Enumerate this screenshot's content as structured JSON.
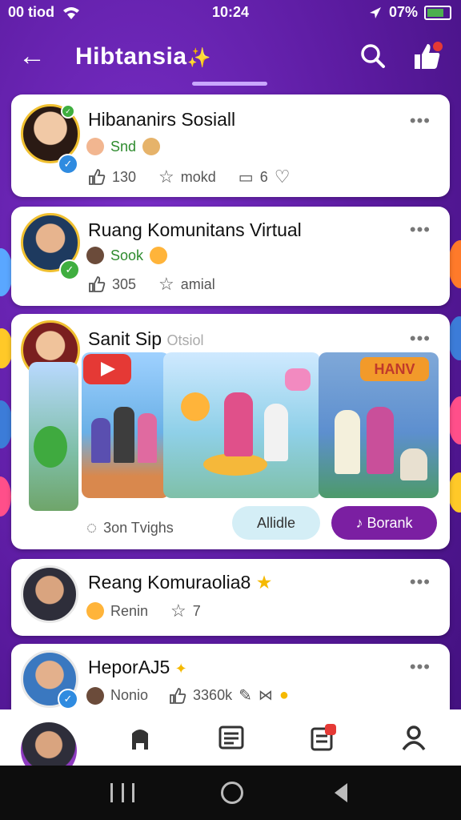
{
  "status": {
    "carrier": "00 tiod",
    "time": "10:24",
    "battery": "07%"
  },
  "header": {
    "title": "Hibtansia",
    "title_emoji": "✨"
  },
  "cards": [
    {
      "title": "Hibananirs Sosiall",
      "sub": "Snd",
      "likes": "130",
      "fav": "mokd",
      "comments": "6"
    },
    {
      "title": "Ruang Komunitans Virtual",
      "sub": "Sook",
      "likes": "305",
      "fav": "amial"
    },
    {
      "title": "Sanit Sip",
      "title_faint": "Otsiol",
      "footer_text": "3on Tvighs",
      "btn1": "Allidle",
      "btn2": "Borank",
      "media_banner": "HANV"
    },
    {
      "title": "Reang Komuraolia8",
      "sub": "Renin",
      "fav": "7"
    },
    {
      "title": "HeporAJ5",
      "sub": "Nonio",
      "likes": "3360k"
    }
  ],
  "colors": {
    "brand": "#6a1fb3",
    "accent": "#7b1fa2",
    "light_button": "#d4eef6",
    "verified": "#2f8be0",
    "online": "#3fae3f"
  }
}
